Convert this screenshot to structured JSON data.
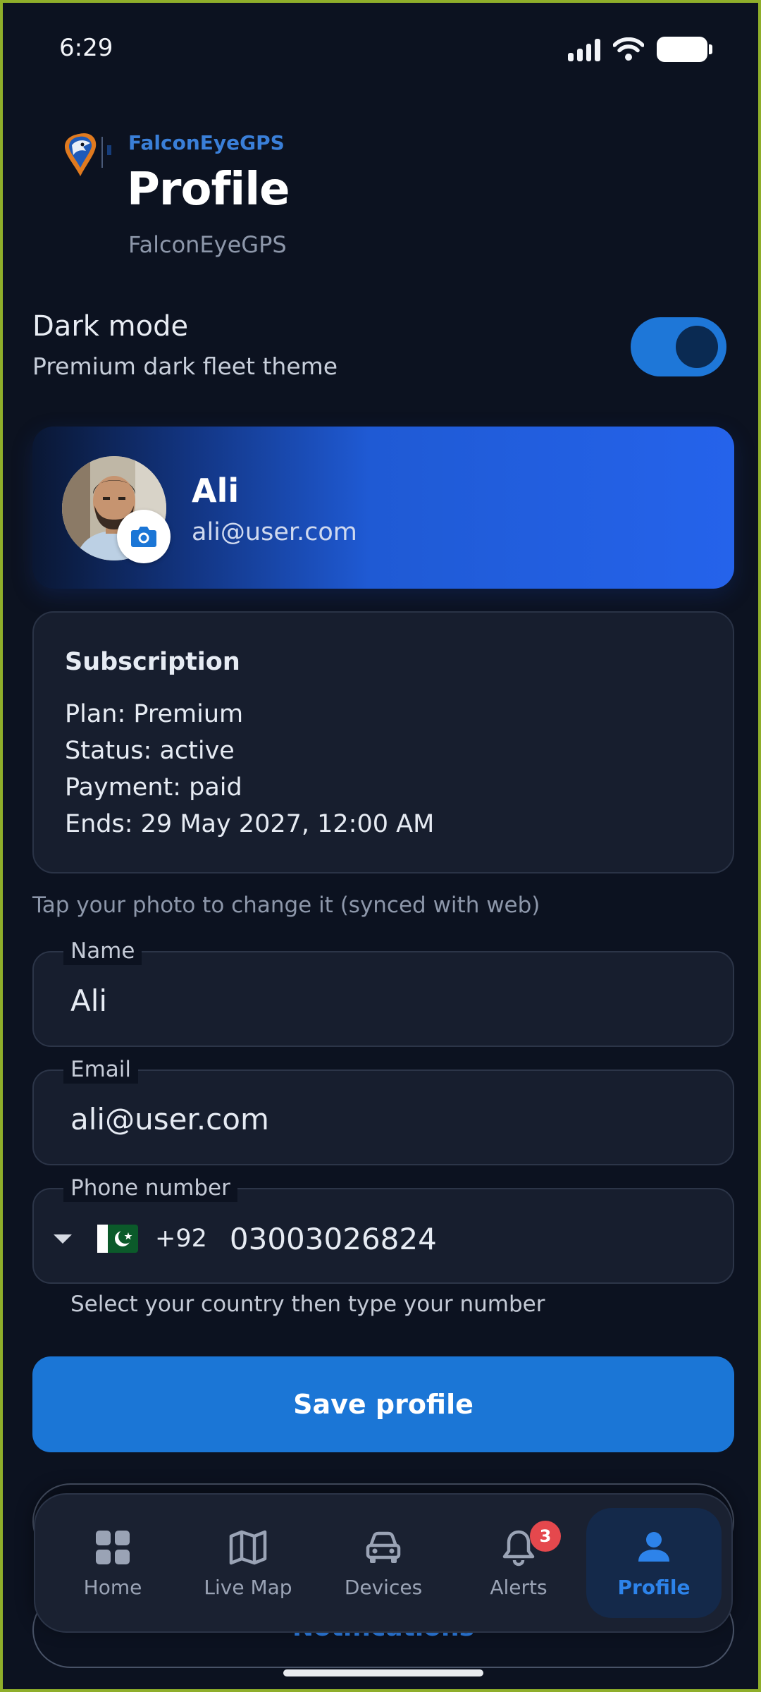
{
  "status_bar": {
    "time": "6:29"
  },
  "header": {
    "brand": "FalconEyeGPS",
    "title": "Profile",
    "subtitle": "FalconEyeGPS"
  },
  "dark_mode": {
    "title": "Dark mode",
    "subtitle": "Premium dark fleet theme",
    "enabled": true
  },
  "profile": {
    "name": "Ali",
    "email": "ali@user.com"
  },
  "subscription": {
    "title": "Subscription",
    "plan": "Plan: Premium",
    "status": "Status: active",
    "payment": "Payment: paid",
    "ends": "Ends: 29 May 2027, 12:00 AM"
  },
  "photo_hint": "Tap your photo to change it (synced with web)",
  "form": {
    "name_label": "Name",
    "name_value": "Ali",
    "email_label": "Email",
    "email_value": "ali@user.com",
    "phone_label": "Phone number",
    "dial_code": "+92",
    "phone_value": "03003026824",
    "phone_helper": "Select your country then type your number"
  },
  "actions": {
    "save_label": "Save profile",
    "notifications_label": "Notifications"
  },
  "nav": {
    "home": "Home",
    "live_map": "Live Map",
    "devices": "Devices",
    "alerts": "Alerts",
    "alerts_badge": "3",
    "profile": "Profile"
  },
  "colors": {
    "background": "#0c1220",
    "accent": "#1b76d6",
    "brand": "#3a7fd8",
    "badge": "#e5484d"
  }
}
